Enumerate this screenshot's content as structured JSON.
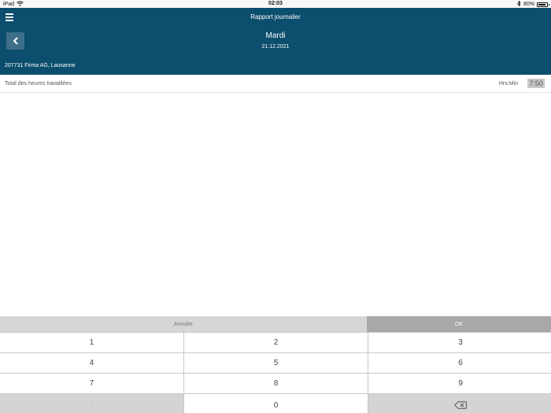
{
  "status_bar": {
    "device": "iPad",
    "time": "02:03",
    "battery": "80%"
  },
  "header": {
    "title": "Rapport journalier",
    "day": "Mardi",
    "date": "21.12.2021",
    "company": "207731 Firma AG, Lausanne"
  },
  "total": {
    "label": "Total des heures travaillées",
    "unit": "Hrs:Min",
    "value": "7:50"
  },
  "keyboard": {
    "cancel_label": "Annuler",
    "ok_label": "OK",
    "keys": [
      "1",
      "2",
      "3",
      "4",
      "5",
      "6",
      "7",
      "8",
      "9",
      ":",
      "0"
    ]
  },
  "icons": {
    "menu": "hamburger-menu-icon",
    "back": "chevron-left-icon",
    "wifi": "wifi-icon",
    "bluetooth": "bluetooth-icon",
    "battery": "battery-icon",
    "backspace": "backspace-icon"
  },
  "colors": {
    "header_bg": "#0c4e6e",
    "back_button": "#3d6f8a",
    "ok_button": "#a8a8a8",
    "cancel_button": "#d6d6d6"
  }
}
